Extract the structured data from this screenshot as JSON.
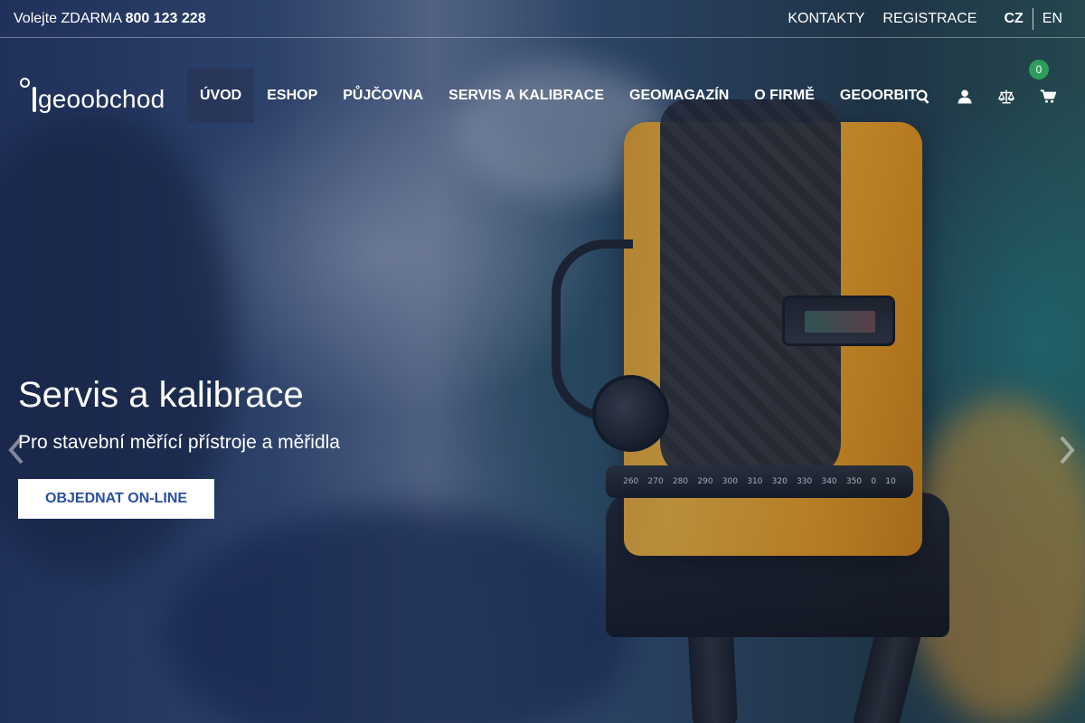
{
  "topbar": {
    "phone_prefix": "Volejte ZDARMA",
    "phone_number": "800 123 228",
    "links": [
      "KONTAKTY",
      "REGISTRACE"
    ],
    "languages": [
      {
        "code": "CZ",
        "active": true
      },
      {
        "code": "EN",
        "active": false
      }
    ]
  },
  "header": {
    "logo_text": "geoobchod",
    "nav": [
      "ÚVOD",
      "ESHOP",
      "PŮJČOVNA",
      "SERVIS A KALIBRACE",
      "GEOMAGAZÍN",
      "O FIRMĚ",
      "GEOORBIT"
    ],
    "active_nav": "ÚVOD",
    "icons": [
      "search-icon",
      "user-icon",
      "compare-scales-icon",
      "cart-icon"
    ],
    "cart_count": "0"
  },
  "slide": {
    "title": "Servis a kalibrace",
    "subtitle": "Pro stavební měřící přístroje a měřidla",
    "button": "OBJEDNAT ON-LINE"
  },
  "device_scale": [
    "260",
    "270",
    "280",
    "290",
    "300",
    "310",
    "320",
    "330",
    "340",
    "350",
    "0",
    "10"
  ],
  "colors": {
    "accent_button_text": "#2a4fa3",
    "cart_badge": "#2e9c5a"
  }
}
